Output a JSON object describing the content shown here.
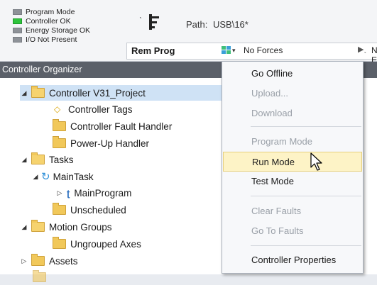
{
  "status": {
    "items": [
      {
        "label": "Program Mode",
        "color": "#8e9298"
      },
      {
        "label": "Controller OK",
        "color": "#2ec43c"
      },
      {
        "label": "Energy Storage OK",
        "color": "#8e9298"
      },
      {
        "label": "I/O Not Present",
        "color": "#8e9298"
      }
    ],
    "path_label": "Path:",
    "path_value": "USB\\16*",
    "mode": "Rem Prog",
    "forces": "No Forces",
    "next_truncated": "No E"
  },
  "organizer": {
    "title": "Controller Organizer",
    "tree": [
      {
        "label": "Controller V31_Project",
        "expander": "◢",
        "icon": "folder-open-icon"
      },
      {
        "label": "Controller Tags",
        "icon": "tag-icon"
      },
      {
        "label": "Controller Fault Handler",
        "icon": "folder-icon"
      },
      {
        "label": "Power-Up Handler",
        "icon": "folder-icon"
      },
      {
        "label": "Tasks",
        "expander": "◢",
        "icon": "folder-open-icon"
      },
      {
        "label": "MainTask",
        "expander": "◢",
        "icon": "task-icon"
      },
      {
        "label": "MainProgram",
        "expander": "▷",
        "icon": "program-icon"
      },
      {
        "label": "Unscheduled",
        "icon": "folder-icon"
      },
      {
        "label": "Motion Groups",
        "expander": "◢",
        "icon": "folder-open-icon"
      },
      {
        "label": "Ungrouped Axes",
        "icon": "folder-icon"
      },
      {
        "label": "Assets",
        "expander": "▷",
        "icon": "folder-icon"
      }
    ]
  },
  "menu": {
    "items": [
      {
        "label": "Go Offline",
        "enabled": true
      },
      {
        "label": "Upload...",
        "enabled": false
      },
      {
        "label": "Download",
        "enabled": false
      },
      {
        "label": "Program Mode",
        "enabled": false
      },
      {
        "label": "Run Mode",
        "enabled": true,
        "hover": true
      },
      {
        "label": "Test Mode",
        "enabled": true
      },
      {
        "label": "Clear Faults",
        "enabled": false
      },
      {
        "label": "Go To Faults",
        "enabled": false
      },
      {
        "label": "Controller Properties",
        "enabled": true
      }
    ],
    "hover_color": "#fdf3c6"
  }
}
